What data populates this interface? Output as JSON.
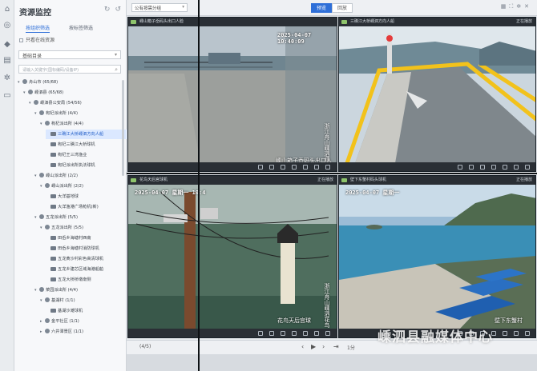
{
  "panel": {
    "title": "资源监控",
    "tabs": [
      "按组织筛选",
      "按标签筛选"
    ],
    "checkbox_label": "只看在线资源",
    "select_value": "基础目录",
    "search_placeholder": "请输入关键字(国标编码/设备IP)"
  },
  "tree": [
    {
      "label": "舟山市 (65/68)",
      "level": 0,
      "kind": "org",
      "caret": "▾"
    },
    {
      "label": "嵊泗县 (65/68)",
      "level": 1,
      "kind": "org",
      "caret": "▾"
    },
    {
      "label": "嵊泗县公安局 (54/56)",
      "level": 2,
      "kind": "org",
      "caret": "▾"
    },
    {
      "label": "枸杞派出所 (4/4)",
      "level": 3,
      "kind": "org",
      "caret": "▾"
    },
    {
      "label": "枸杞派出所 (4/4)",
      "level": 4,
      "kind": "org",
      "caret": "▾"
    },
    {
      "label": "三礁江大桥嵊泗方向人船",
      "level": 5,
      "kind": "cam",
      "caret": "",
      "selected": true
    },
    {
      "label": "枸杞三礁江大桥球机",
      "level": 5,
      "kind": "cam",
      "caret": ""
    },
    {
      "label": "枸杞王三湾渔业",
      "level": 5,
      "kind": "cam",
      "caret": ""
    },
    {
      "label": "枸杞派出所执法球机",
      "level": 5,
      "kind": "cam",
      "caret": ""
    },
    {
      "label": "嵊山派出所 (2/2)",
      "level": 3,
      "kind": "org",
      "caret": "▾"
    },
    {
      "label": "嵊山派出所 (2/2)",
      "level": 4,
      "kind": "org",
      "caret": "▾"
    },
    {
      "label": "大洋基地球",
      "level": 5,
      "kind": "cam",
      "caret": ""
    },
    {
      "label": "大洋渔港广场枪机(新)",
      "level": 5,
      "kind": "cam",
      "caret": ""
    },
    {
      "label": "五龙派出所 (5/5)",
      "level": 3,
      "kind": "org",
      "caret": "▾"
    },
    {
      "label": "五龙派出所 (5/5)",
      "level": 4,
      "kind": "org",
      "caret": "▾"
    },
    {
      "label": "田岙乡海塘村西南",
      "level": 5,
      "kind": "cam",
      "caret": ""
    },
    {
      "label": "田岙乡海塘村消防球机",
      "level": 5,
      "kind": "cam",
      "caret": ""
    },
    {
      "label": "五龙黄沙村彩色高清球机",
      "level": 5,
      "kind": "cam",
      "caret": ""
    },
    {
      "label": "五龙乡建芯区域海港船舶",
      "level": 5,
      "kind": "cam",
      "caret": ""
    },
    {
      "label": "五龙大桥桥墩南侧",
      "level": 5,
      "kind": "cam",
      "caret": ""
    },
    {
      "label": "菜园派出所 (4/4)",
      "level": 3,
      "kind": "org",
      "caret": "▾"
    },
    {
      "label": "基湖村 (1/1)",
      "level": 4,
      "kind": "org",
      "caret": "▾"
    },
    {
      "label": "基湖沙滩球机",
      "level": 5,
      "kind": "cam",
      "caret": ""
    },
    {
      "label": "金平社区 (1/1)",
      "level": 4,
      "kind": "org",
      "caret": "▸"
    },
    {
      "label": "六井潭景区 (1/1)",
      "level": 4,
      "kind": "org",
      "caret": "▸"
    }
  ],
  "topbar": {
    "layout_select": "公有按需分组",
    "seg": [
      "预览",
      "回放"
    ],
    "active_seg": "预览"
  },
  "cells": [
    {
      "head": "嵊山箱子岙码头出口人脸",
      "status": "",
      "timestamp": "2025-04-07 10:40:09",
      "osd_vertical": "浙江舟山嵊泗嵊山",
      "osd_bottom": "嵊山箱子岙码头出口人脸"
    },
    {
      "head": "三礁江大桥嵊泗方向人船",
      "status": "正在播放",
      "timestamp": "",
      "osd_vertical": "",
      "osd_bottom": ""
    },
    {
      "head": "花鸟天后宫球机",
      "status": "正在播放",
      "timestamp": "2025-04-07 星期一 10:4",
      "osd_vertical": "浙江舟山嵊泗花鸟",
      "osd_bottom": "花鸟天后宫球"
    },
    {
      "head": "壁下东蟹村码头球机",
      "status": "正在播放",
      "timestamp": "2025-04-07 星期一",
      "osd_vertical": "",
      "osd_bottom": "壁下东蟹村"
    }
  ],
  "pager": {
    "count": "(4/5)",
    "right_text": "1分"
  },
  "watermark": "嵊泗县融媒体中心",
  "colors": {
    "accent": "#2e6fd8",
    "selected_bg": "#dbe8ff",
    "panel_bg": "#f7f8fa"
  }
}
